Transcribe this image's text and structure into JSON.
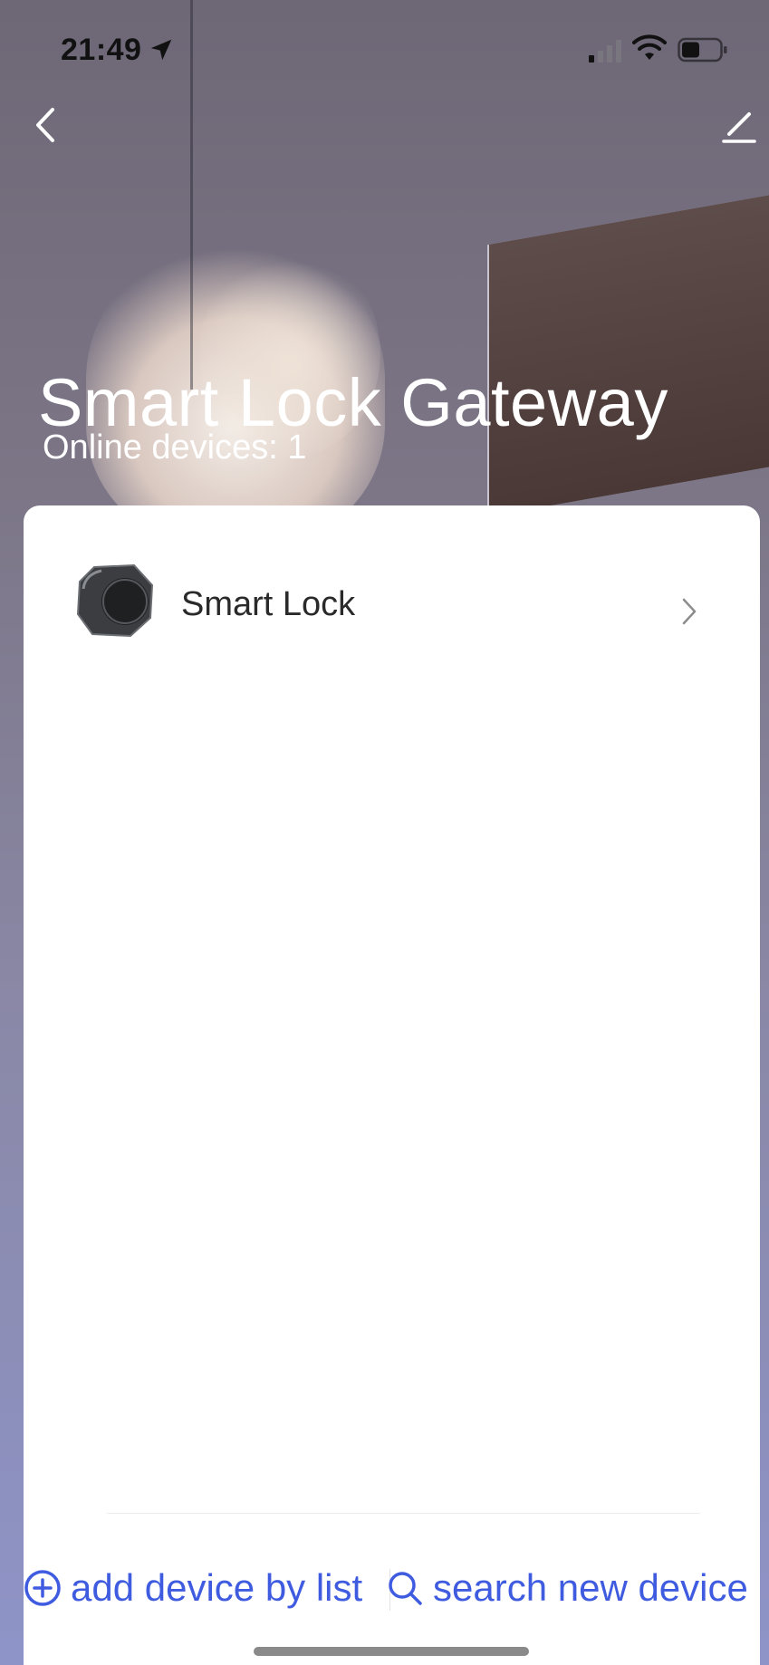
{
  "status_bar": {
    "time": "21:49",
    "icons": [
      "location-arrow-icon",
      "cellular-signal-icon",
      "wifi-icon",
      "battery-icon"
    ]
  },
  "nav": {
    "back_icon": "chevron-left-icon",
    "edit_icon": "edit-pencil-icon"
  },
  "header": {
    "title": "Smart Lock Gateway",
    "subtitle": "Online devices: 1"
  },
  "devices": [
    {
      "name": "Smart Lock",
      "icon": "smart-lock-device-image"
    }
  ],
  "actions": {
    "add_label": "add device by list",
    "add_icon": "plus-circle-icon",
    "search_label": "search new device",
    "search_icon": "search-icon"
  },
  "colors": {
    "accent": "#3f5ce0",
    "title_text": "#ffffff",
    "card_bg": "#ffffff"
  }
}
